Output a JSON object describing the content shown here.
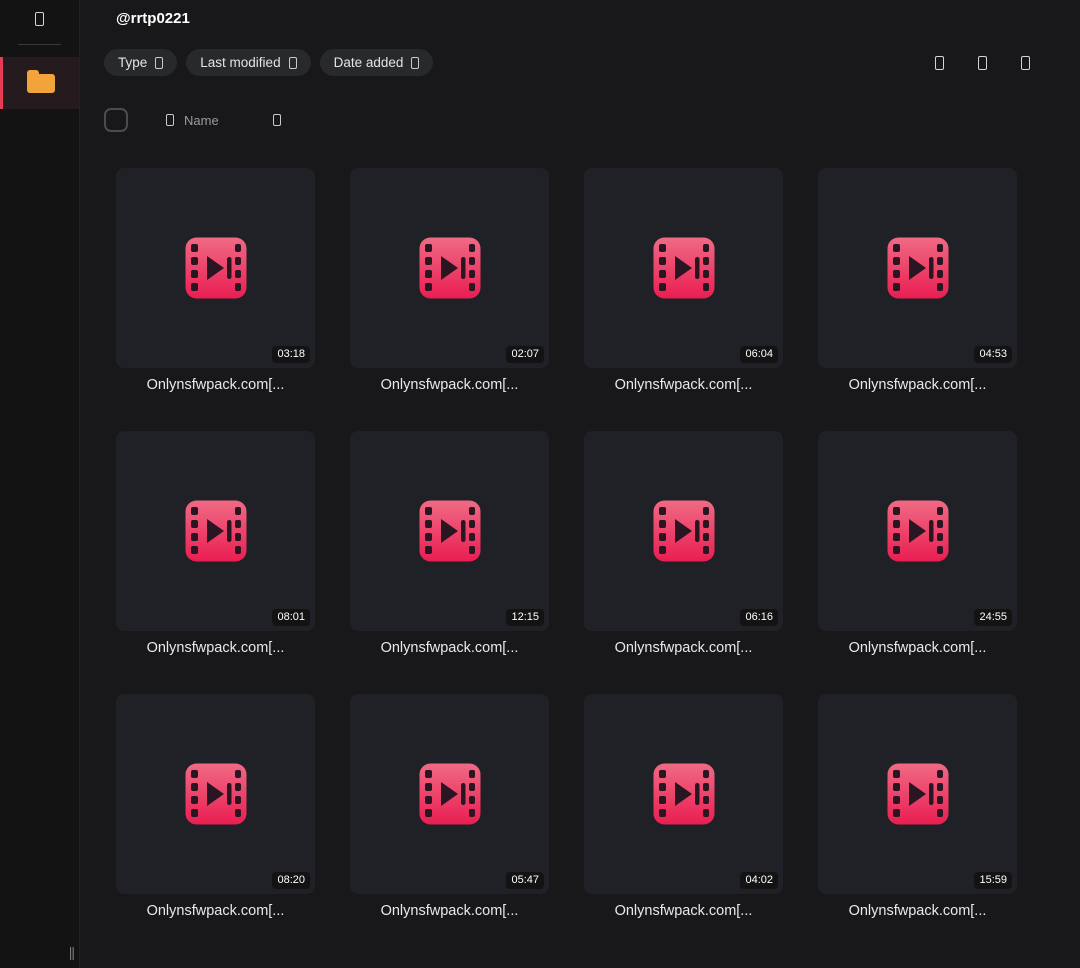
{
  "window": {
    "title": "@rrtp0221"
  },
  "colors": {
    "accent_red": "#e83b55",
    "folder_orange": "#f2a33c",
    "icon_gradient_top": "#f06a84",
    "icon_gradient_bottom": "#e91e52",
    "icon_hole": "#2a1522",
    "card_bg": "#202126"
  },
  "sidebar": {
    "top_icon": "app-menu-glyph",
    "active_item_icon": "folder-icon",
    "resize_handle": "||"
  },
  "filters": [
    {
      "label": "Type"
    },
    {
      "label": "Last modified"
    },
    {
      "label": "Date added"
    }
  ],
  "toolbar": {
    "icons": [
      "toolbar-glyph-1",
      "toolbar-glyph-2",
      "toolbar-glyph-3"
    ]
  },
  "list_header": {
    "name": "Name"
  },
  "files": [
    {
      "name": "Onlynsfwpack.com[...",
      "duration": "03:18"
    },
    {
      "name": "Onlynsfwpack.com[...",
      "duration": "02:07"
    },
    {
      "name": "Onlynsfwpack.com[...",
      "duration": "06:04"
    },
    {
      "name": "Onlynsfwpack.com[...",
      "duration": "04:53"
    },
    {
      "name": "Onlynsfwpack.com[...",
      "duration": "08:01"
    },
    {
      "name": "Onlynsfwpack.com[...",
      "duration": "12:15"
    },
    {
      "name": "Onlynsfwpack.com[...",
      "duration": "06:16"
    },
    {
      "name": "Onlynsfwpack.com[...",
      "duration": "24:55"
    },
    {
      "name": "Onlynsfwpack.com[...",
      "duration": "08:20"
    },
    {
      "name": "Onlynsfwpack.com[...",
      "duration": "05:47"
    },
    {
      "name": "Onlynsfwpack.com[...",
      "duration": "04:02"
    },
    {
      "name": "Onlynsfwpack.com[...",
      "duration": "15:59"
    }
  ]
}
